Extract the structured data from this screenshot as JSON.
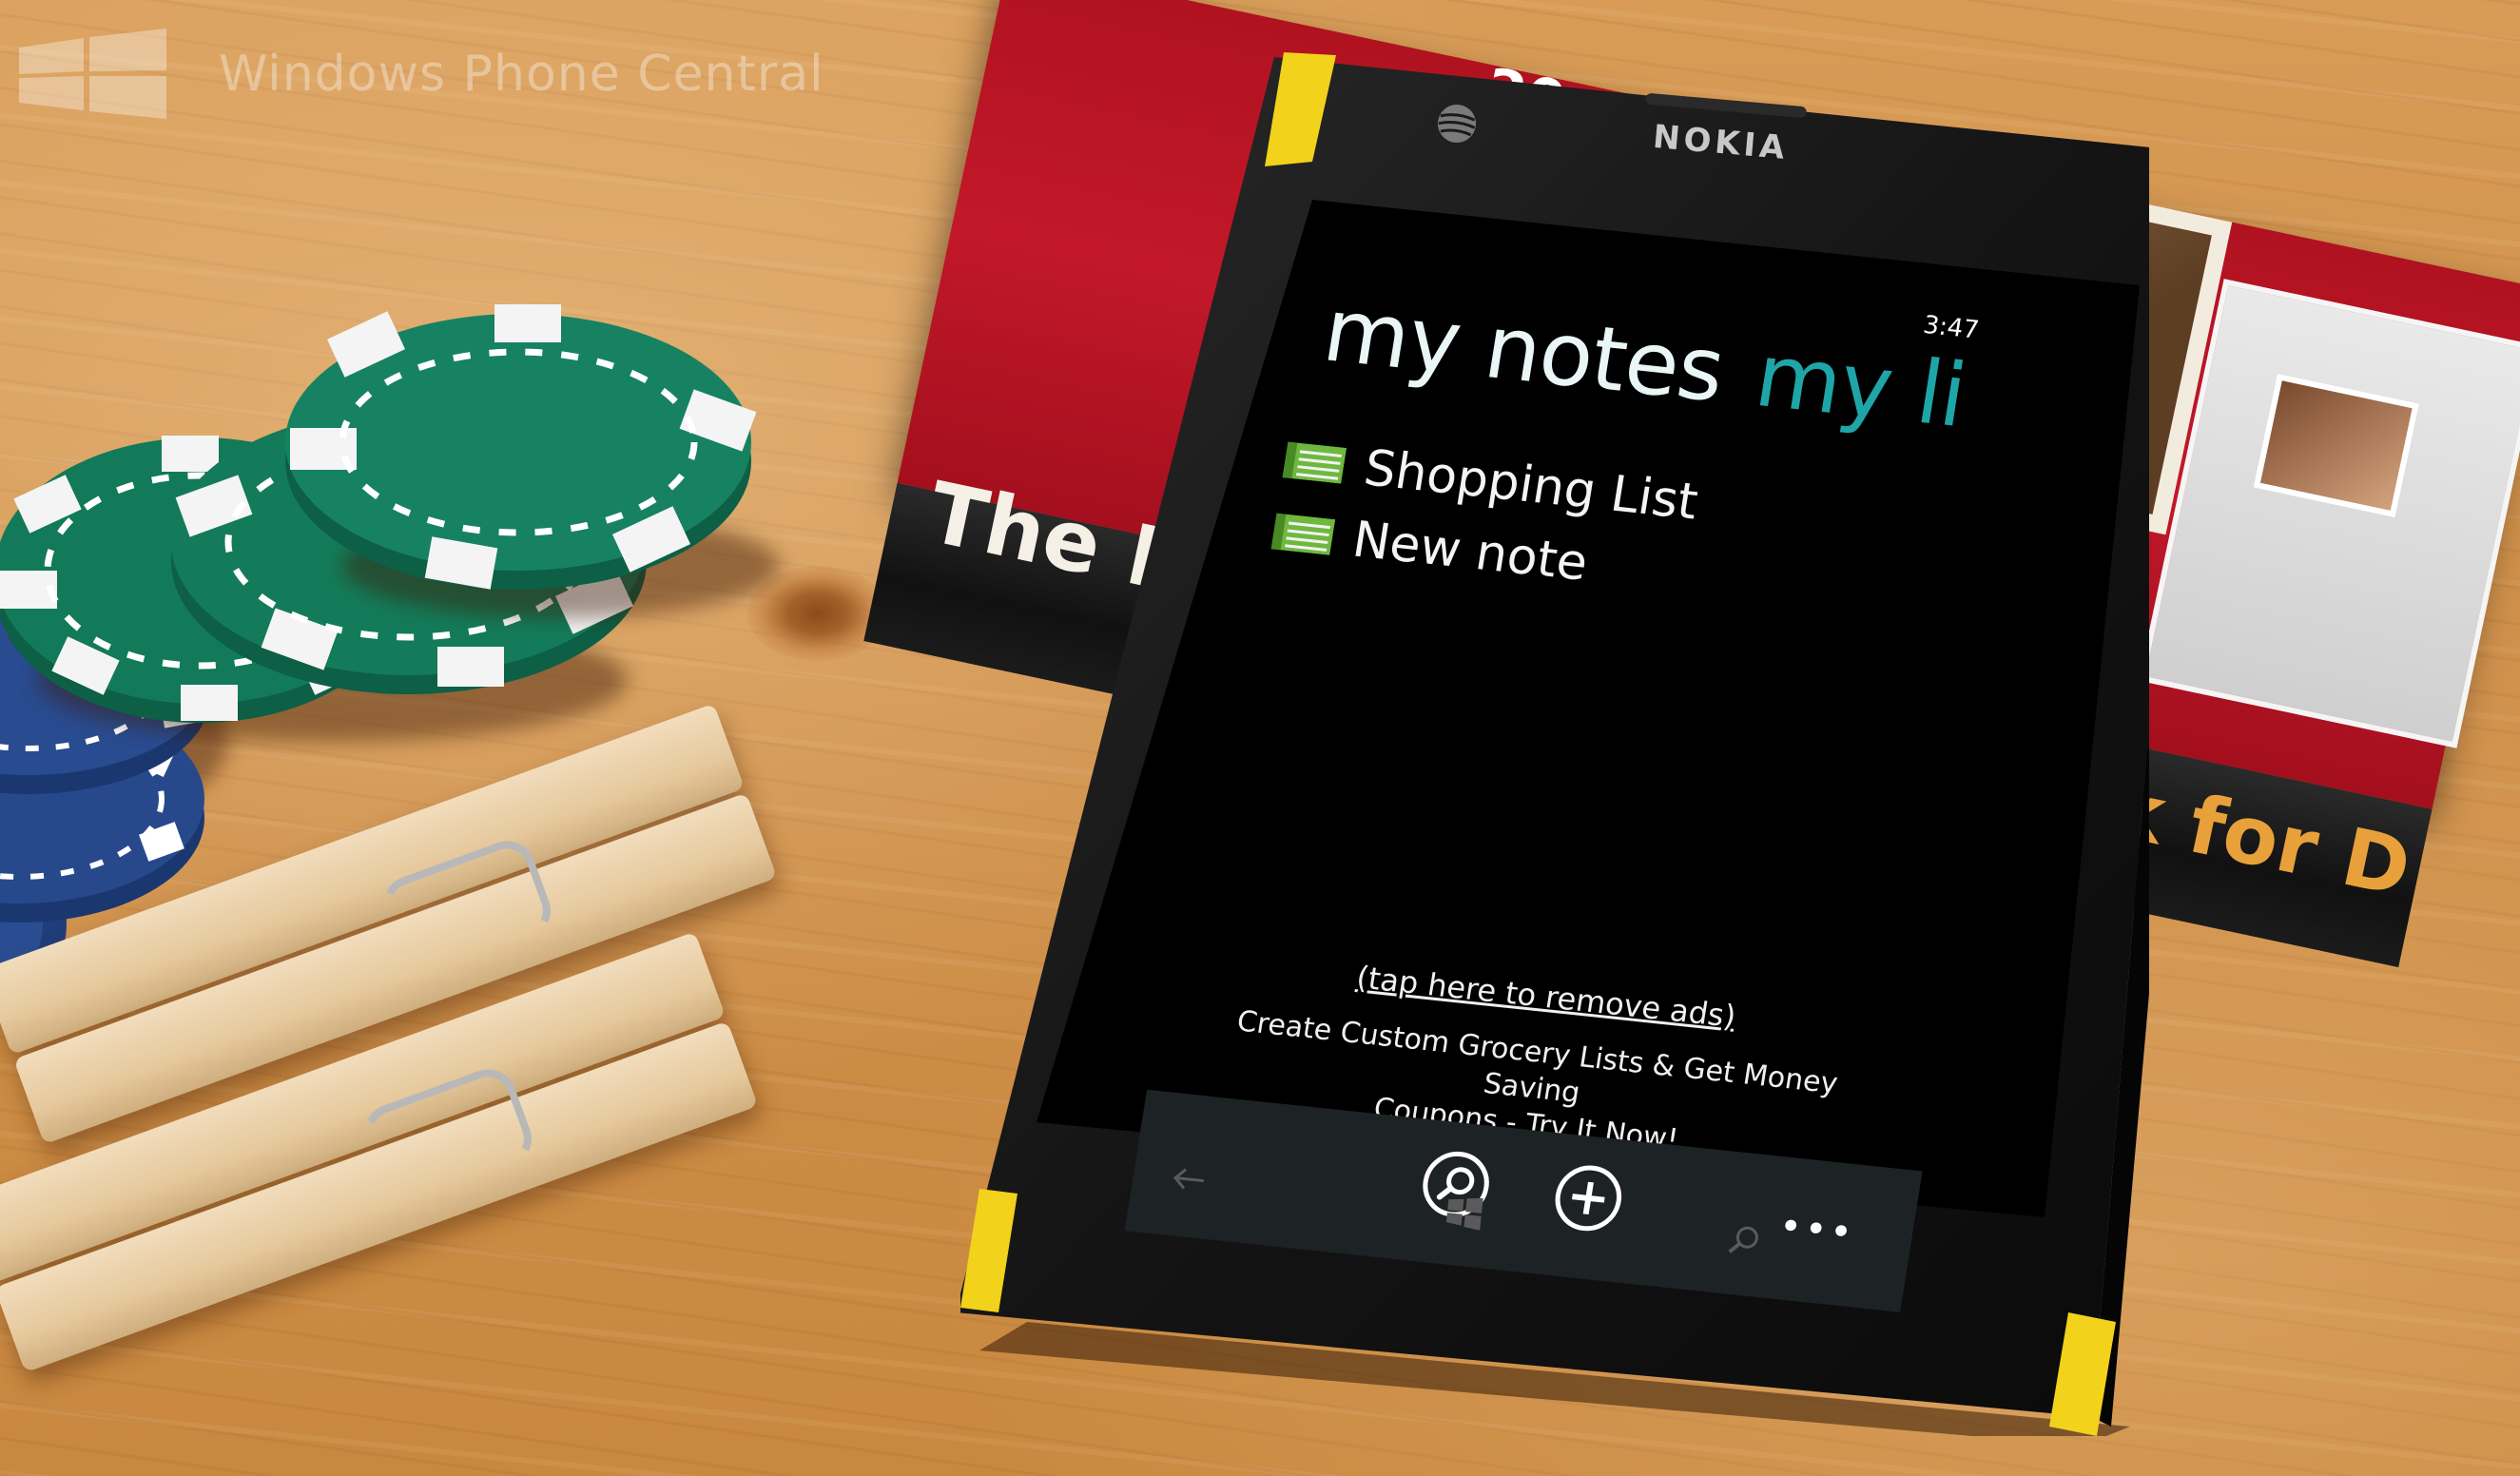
{
  "watermark": {
    "text": "Windows Phone Central"
  },
  "book": {
    "spine_text_1": "The P",
    "spine_text_2": "Book for D",
    "cover_number": "20-"
  },
  "phone": {
    "brand": "NOKIA",
    "colors": {
      "body": "#161616",
      "bumper": "#f2d21a",
      "screen": "#000000",
      "accent": "#1fa5a8",
      "appbar": "#1d2224"
    },
    "status": {
      "time": "3:47"
    },
    "pivot": {
      "active_label": "my notes",
      "next_label": "my lis"
    },
    "notes": [
      {
        "label": "Shopping List",
        "icon": "note-icon"
      },
      {
        "label": "New note",
        "icon": "note-icon"
      }
    ],
    "ad": {
      "remove_link": "(tap here to remove ads)",
      "line1": "Create Custom Grocery Lists & Get Money Saving",
      "line2": "Coupons - Try It Now!"
    },
    "appbar": {
      "search_icon": "search-icon",
      "add_icon": "add-icon",
      "more_label": "•••"
    },
    "hardware_buttons": {
      "back": "back-icon",
      "start": "windows-icon",
      "search": "search-icon"
    }
  }
}
